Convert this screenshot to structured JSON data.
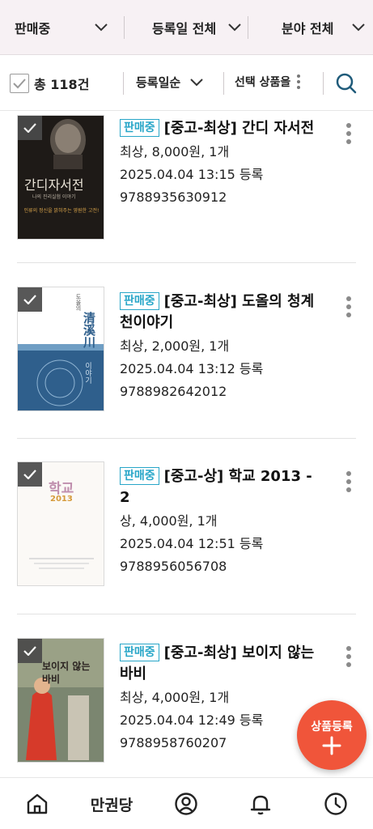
{
  "filters": {
    "status": "판매중",
    "date": "등록일 전체",
    "category": "분야 전체"
  },
  "toolbar": {
    "total": "총 118건",
    "sort": "등록일순",
    "bulk": "선택 상품을"
  },
  "items": [
    {
      "badge": "판매중",
      "title": "[중고-최상] 간디 자서전",
      "meta": "최상, 8,000원, 1개",
      "date": "2025.04.04 13:15 등록",
      "isbn": "9788935630912",
      "cover_title": "간디자서전",
      "cover_sub": "나의 진리실험 이야기",
      "cover_quote": "인류의 정신을 밝혀주는 영원한 고전!"
    },
    {
      "badge": "판매중",
      "title": "[중고-최상] 도올의 청계천이야기",
      "meta": "최상, 2,000원, 1개",
      "date": "2025.04.04 13:12 등록",
      "isbn": "9788982642012",
      "cover_title": "清溪川",
      "cover_sub": "도올의",
      "cover_side": "이야기"
    },
    {
      "badge": "판매중",
      "title": "[중고-상] 학교 2013 - 2",
      "meta": "상, 4,000원, 1개",
      "date": "2025.04.04 12:51 등록",
      "isbn": "9788956056708",
      "cover_title": "학교",
      "cover_num": "2013"
    },
    {
      "badge": "판매중",
      "title": "[중고-최상] 보이지 않는 바비",
      "meta": "최상, 4,000원, 1개",
      "date": "2025.04.04 12:49 등록",
      "isbn": "9788958760207",
      "cover_title": "보이지 않는 바비"
    }
  ],
  "fab": {
    "label": "상품등록"
  },
  "nav": {
    "brand": "만권당"
  },
  "colors": {
    "accent": "#28a6c8",
    "fab": "#f0553a",
    "filter_bg": "#f7f1f4",
    "search": "#1f5b7a"
  }
}
